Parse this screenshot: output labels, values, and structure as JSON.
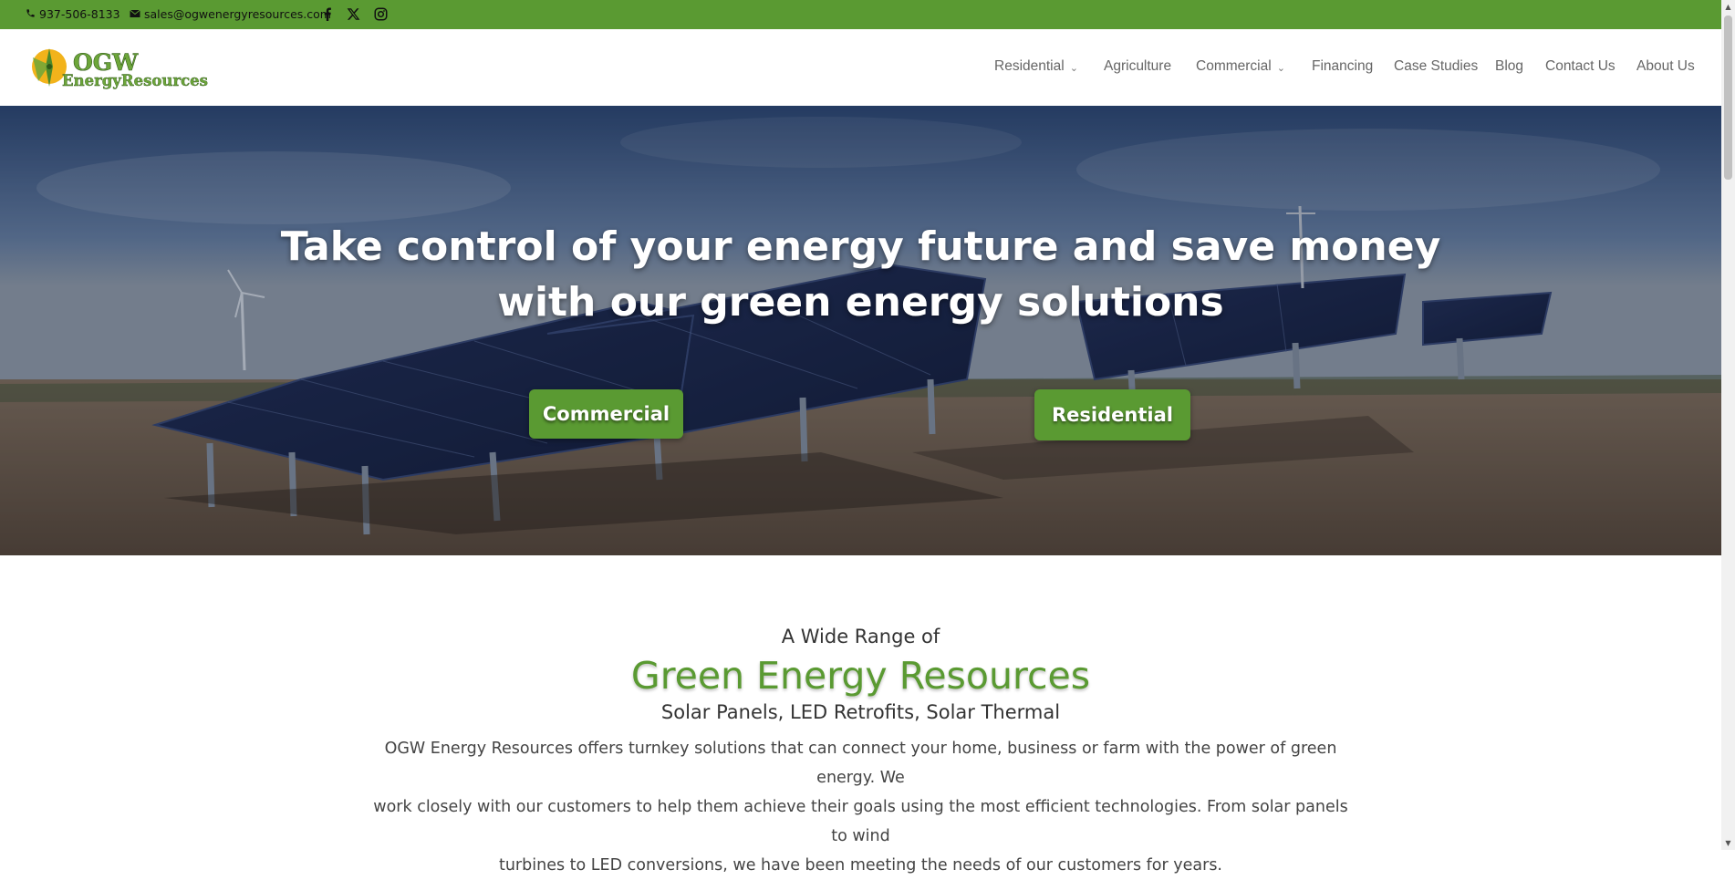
{
  "topbar": {
    "phone": "937-506-8133",
    "email": "sales@ogwenergyresources.com",
    "social": [
      "facebook-icon",
      "x-icon",
      "instagram-icon"
    ],
    "color": "#5a9a32"
  },
  "logo": {
    "line1": "OGW",
    "line2": "EnergyResources"
  },
  "nav": {
    "items": [
      {
        "label": "Residential",
        "dropdown": true
      },
      {
        "label": "Agriculture",
        "dropdown": false
      },
      {
        "label": "Commercial",
        "dropdown": true
      },
      {
        "label": "Financing",
        "dropdown": false
      },
      {
        "label": "Case Studies",
        "dropdown": false
      },
      {
        "label": "Blog",
        "dropdown": false
      },
      {
        "label": "Contact Us",
        "dropdown": false
      },
      {
        "label": "About Us",
        "dropdown": false
      }
    ]
  },
  "hero": {
    "title_line1": "Take control of your energy future and save money",
    "title_line2": "with our green energy solutions",
    "buttons": {
      "commercial": "Commercial",
      "residential": "Residential"
    }
  },
  "section": {
    "pre_heading": "A Wide Range of",
    "heading": "Green Energy Resources",
    "subheading": "Solar Panels, LED Retrofits, Solar Thermal",
    "para_line1": "OGW Energy Resources offers turnkey solutions that can connect your home, business or farm with the power of green energy. We",
    "para_line2": "work closely with our customers to help them achieve their goals using the most efficient technologies. From solar panels to wind",
    "para_line3": "turbines to LED conversions, we have been meeting the needs of our customers for years."
  },
  "colors": {
    "accent": "#5a9a32",
    "heading_green": "#5a9a32"
  }
}
